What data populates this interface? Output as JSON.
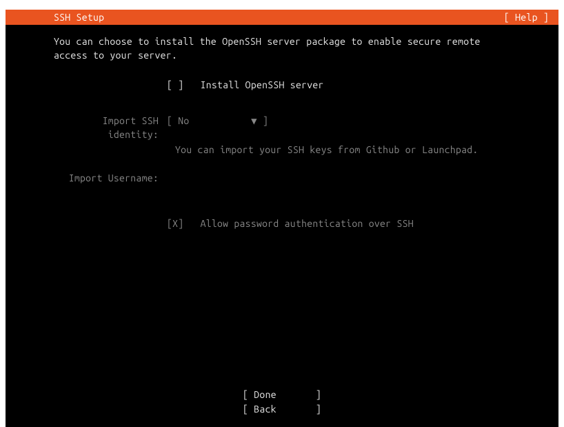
{
  "titlebar": {
    "title": "SSH Setup",
    "help": "[ Help ]"
  },
  "description": {
    "line1": "You can choose to install the OpenSSH server package to enable secure remote",
    "line2": "access to your server."
  },
  "form": {
    "install_openssh": {
      "mark": " ",
      "checked": false,
      "label": "Install OpenSSH server"
    },
    "import_identity": {
      "label": "Import SSH identity:",
      "value": "No",
      "note": "You can import your SSH keys from Github or Launchpad."
    },
    "import_username": {
      "label": "Import Username:",
      "value": ""
    },
    "allow_password_auth": {
      "mark": "X",
      "checked": true,
      "label": "Allow password authentication over SSH"
    }
  },
  "footer": {
    "done": "Done",
    "back": "Back"
  }
}
